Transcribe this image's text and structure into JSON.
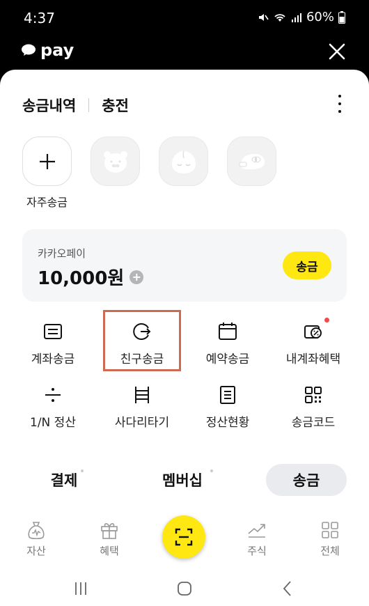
{
  "status_bar": {
    "time": "4:37",
    "battery": "60%"
  },
  "header": {
    "logo_text": "pay"
  },
  "top_tabs": [
    {
      "label": "송금내역"
    },
    {
      "label": "충전"
    }
  ],
  "frequent": {
    "add_label": "자주송금"
  },
  "balance": {
    "name": "카카오페이",
    "amount": "10,000원",
    "plus": "+",
    "send_label": "송금"
  },
  "menu": {
    "row1": [
      {
        "label": "계좌송금"
      },
      {
        "label": "친구송금"
      },
      {
        "label": "예약송금"
      },
      {
        "label": "내계좌혜택"
      }
    ],
    "row2": [
      {
        "label": "1/N 정산"
      },
      {
        "label": "사다리타기"
      },
      {
        "label": "정산현황"
      },
      {
        "label": "송금코드"
      }
    ]
  },
  "mode_tabs": [
    {
      "label": "결제"
    },
    {
      "label": "멤버십"
    },
    {
      "label": "송금"
    }
  ],
  "bottom_nav": [
    {
      "label": "자산"
    },
    {
      "label": "혜택"
    },
    {
      "label": "주식"
    },
    {
      "label": "전체"
    }
  ],
  "colors": {
    "accent_yellow": "#ffe812",
    "highlight": "#cc6a52",
    "notification": "#f04a4a"
  }
}
